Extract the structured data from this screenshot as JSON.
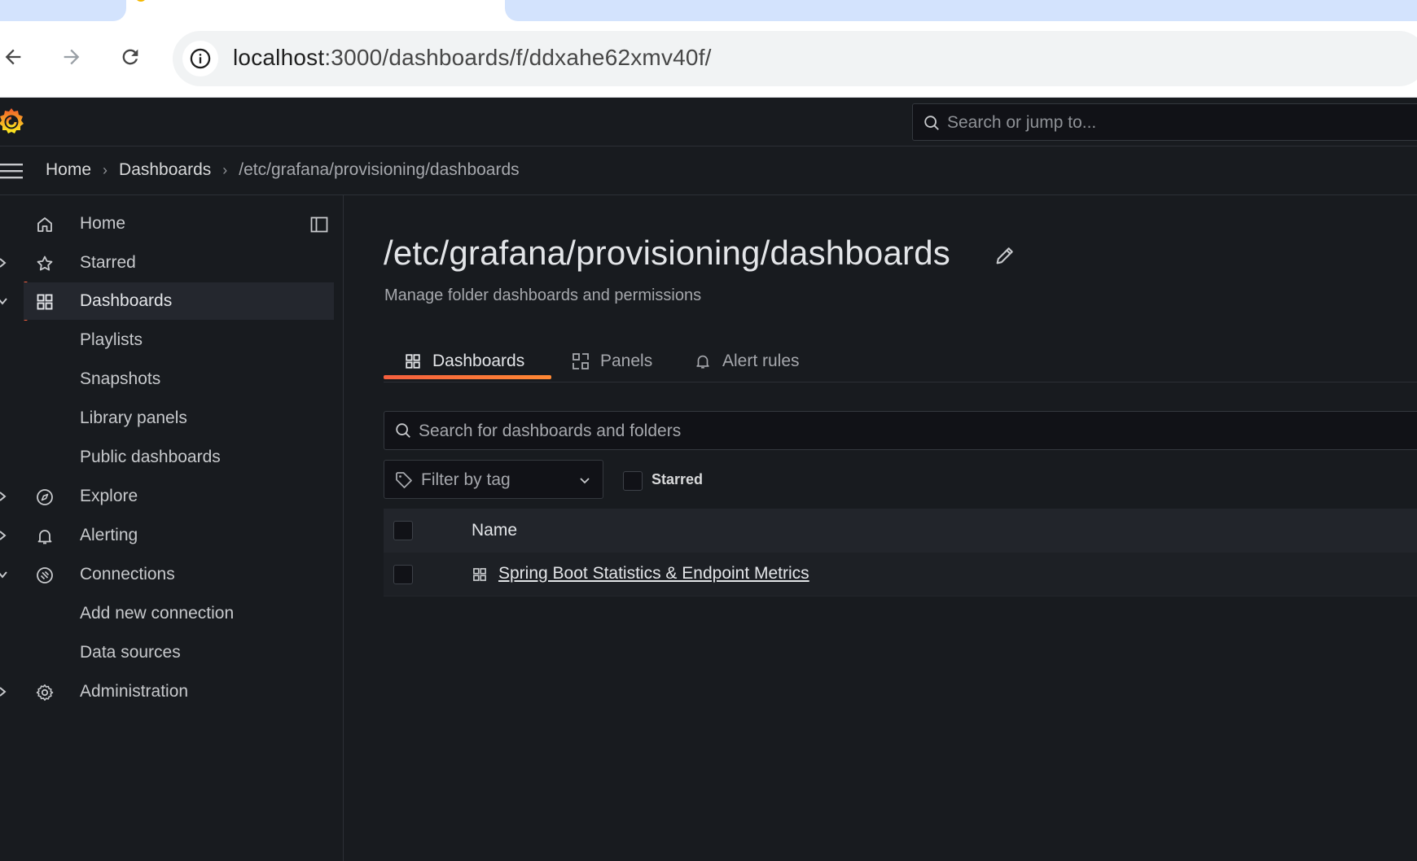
{
  "browser": {
    "url_host": "localhost",
    "url_rest": ":3000/dashboards/f/ddxahe62xmv40f/"
  },
  "topbar": {
    "search_placeholder": "Search or jump to..."
  },
  "breadcrumb": {
    "items": [
      "Home",
      "Dashboards",
      "/etc/grafana/provisioning/dashboards"
    ]
  },
  "sidebar": {
    "items": [
      {
        "label": "Home",
        "icon": "home-icon"
      },
      {
        "label": "Starred",
        "icon": "star-icon"
      },
      {
        "label": "Dashboards",
        "icon": "apps-icon"
      },
      {
        "label": "Playlists"
      },
      {
        "label": "Snapshots"
      },
      {
        "label": "Library panels"
      },
      {
        "label": "Public dashboards"
      },
      {
        "label": "Explore",
        "icon": "compass-icon"
      },
      {
        "label": "Alerting",
        "icon": "bell-icon"
      },
      {
        "label": "Connections",
        "icon": "plug-icon"
      },
      {
        "label": "Add new connection"
      },
      {
        "label": "Data sources"
      },
      {
        "label": "Administration",
        "icon": "gear-icon"
      }
    ]
  },
  "main": {
    "title": "/etc/grafana/provisioning/dashboards",
    "subtitle": "Manage folder dashboards and permissions",
    "tabs": [
      {
        "label": "Dashboards",
        "active": true
      },
      {
        "label": "Panels"
      },
      {
        "label": "Alert rules"
      }
    ],
    "search_placeholder": "Search for dashboards and folders",
    "tag_filter_placeholder": "Filter by tag",
    "starred_label": "Starred",
    "table": {
      "header_name": "Name",
      "rows": [
        {
          "name": "Spring Boot Statistics & Endpoint Metrics",
          "type": "dashboard"
        }
      ]
    }
  },
  "colors": {
    "accent": "#f55f3e",
    "background": "#181b1f",
    "browser_tab_active": "#d3e3fd"
  }
}
